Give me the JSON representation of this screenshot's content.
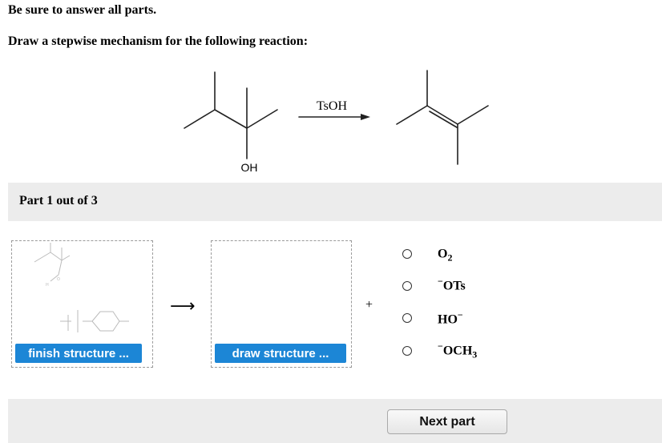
{
  "instructions": {
    "line1": "Be sure to answer all parts.",
    "line2": "Draw a stepwise mechanism for the following reaction:"
  },
  "reaction": {
    "reagent": "TsOH",
    "substituent": "OH"
  },
  "part": {
    "label": "Part 1 out of 3"
  },
  "workspace": {
    "finish_button": "finish structure ...",
    "draw_button": "draw structure ...",
    "preview_h": "H",
    "preview_o": "O",
    "plus": "+"
  },
  "options": [
    {
      "main": "O",
      "sub": "2",
      "sup": "",
      "post": ""
    },
    {
      "main": "OTs",
      "sub": "",
      "sup": "−",
      "post": ""
    },
    {
      "main": "HO",
      "sub": "",
      "sup": "−",
      "post": ""
    },
    {
      "main": "OCH",
      "sub": "3",
      "sup": "−",
      "post": ""
    }
  ],
  "footer": {
    "next_button": "Next part"
  }
}
